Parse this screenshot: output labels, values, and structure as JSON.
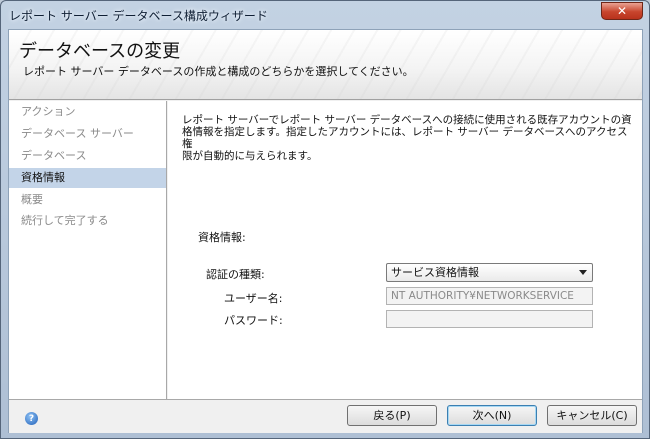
{
  "window": {
    "title": "レポート サーバー データベース構成ウィザード",
    "close_glyph": "✕"
  },
  "header": {
    "title": "データベースの変更",
    "subtitle": "レポート サーバー データベースの作成と構成のどちらかを選択してください。"
  },
  "nav": {
    "items": [
      {
        "label": "アクション"
      },
      {
        "label": "データベース サーバー"
      },
      {
        "label": "データベース"
      },
      {
        "label": "資格情報",
        "active": true
      },
      {
        "label": "概要"
      },
      {
        "label": "続行して完了する"
      }
    ]
  },
  "main": {
    "description_line1": "レポート サーバーでレポート サーバー データベースへの接続に使用される既存アカウントの資",
    "description_line2": "格情報を指定します。指定したアカウントには、レポート サーバー データベースへのアクセス権",
    "description_line3": "限が自動的に与えられます。",
    "section_label": "資格情報:",
    "auth_type_label": "認証の種類:",
    "auth_type_value": "サービス資格情報",
    "username_label": "ユーザー名:",
    "username_value": "NT AUTHORITY¥NETWORKSERVICE",
    "password_label": "パスワード:",
    "password_value": ""
  },
  "footer": {
    "help_glyph": "?",
    "back_label": "戻る(P)",
    "next_label": "次へ(N)",
    "cancel_label": "キャンセル(C)"
  }
}
